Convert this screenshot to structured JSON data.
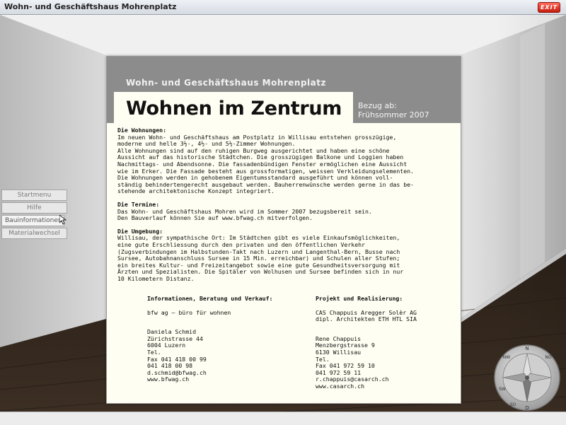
{
  "window": {
    "title": "Wohn- und Geschäftshaus Mohrenplatz",
    "exit_label": "EXIT"
  },
  "menu": {
    "items": [
      {
        "label": "Startmenu"
      },
      {
        "label": "Hilfe"
      },
      {
        "label": "Bauinformationen"
      },
      {
        "label": "Materialwechsel"
      }
    ]
  },
  "panel": {
    "subtitle": "Wohn- und Geschäftshaus Mohrenplatz",
    "headline": "Wohnen im Zentrum",
    "move_in_label": "Bezug ab:",
    "move_in_date": "Frühsommer 2007",
    "sections": [
      {
        "heading": "Die Wohnungen:",
        "text": "Im neuen Wohn- und Geschäftshaus am Postplatz in Willisau entstehen grosszügige,\nmoderne und helle 3½-, 4½- und 5½-Zimmer Wohnungen.\nAlle Wohnungen sind auf den ruhigen Burgweg ausgerichtet und haben eine schöne\nAussicht auf das historische Städtchen. Die grosszügigen Balkone und Loggien haben\nNachmittags- und Abendsonne. Die fassadenbündigen Fenster ermöglichen eine Aussicht\nwie im Erker. Die Fassade besteht aus grossformatigen, weissen Verkleidungselementen.\nDie Wohnungen werden in gehobenem Eigentumsstandard ausgeführt und können voll-\nständig behindertengerecht ausgebaut werden. Bauherrenwünsche werden gerne in das be-\nstehende architektonische Konzept integriert."
      },
      {
        "heading": "Die Termine:",
        "text": "Das Wohn- und Geschäftshaus Mohren wird im Sommer 2007 bezugsbereit sein.\nDen Bauverlauf können Sie auf www.bfwag.ch mitverfolgen."
      },
      {
        "heading": "Die Umgebung:",
        "text": "Willisau, der sympathische Ort: Im Städtchen gibt es viele Einkaufsmöglichkeiten,\neine gute Erschliessung durch den privaten und den öffentlichen Verkehr\n(Zugsverbindungen im Halbstunden-Takt nach Luzern und Langenthal-Bern, Busse nach\nSursee, Autobahnanschluss Sursee in 15 Min. erreichbar) und Schulen aller Stufen;\nein breites Kultur- und Freizeitangebot sowie eine gute Gesundheitsversorgung mit\nÄrzten und Spezialisten. Die Spitäler von Wolhusen und Sursee befinden sich in nur\n10 Kilometern Distanz."
      }
    ],
    "contact_left": {
      "heading": "Informationen, Beratung und Verkauf:",
      "firm": "bfw ag — büro für wohnen",
      "lines": [
        "Daniela Schmid",
        "Zürichstrasse 44",
        "6004 Luzern",
        "Tel.",
        "Fax 041 418 00 99",
        "041 418 00 98",
        "d.schmid@bfwag.ch",
        "www.bfwag.ch"
      ]
    },
    "contact_right": {
      "heading": "Projekt und Realisierung:",
      "firm": "CAS Chappuis Aregger Solèr AG",
      "firm2": "dipl. Architekten ETH HTL SIA",
      "lines": [
        "Rene Chappuis",
        "Menzbergstrasse 9",
        "6130 Willisau",
        "Tel.",
        "Fax 041 972 59 10",
        "041 972 59 11",
        "r.chappuis@casarch.ch",
        "www.casarch.ch"
      ]
    }
  },
  "compass": {
    "labels": [
      "N",
      "NW",
      "SW",
      "SO",
      "O",
      "NO"
    ]
  }
}
